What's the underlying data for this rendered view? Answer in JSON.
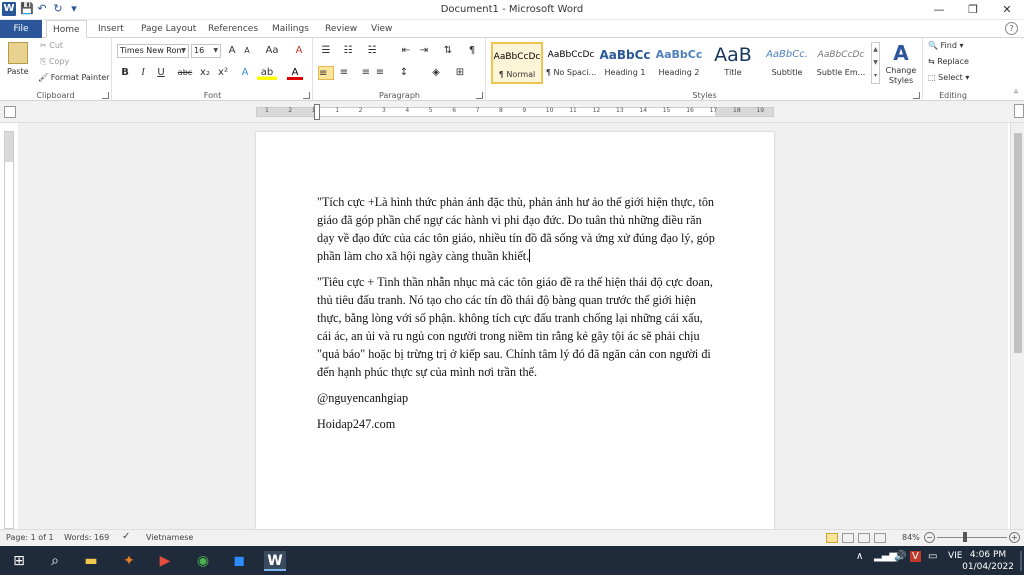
{
  "window": {
    "title": "Document1 - Microsoft Word",
    "minimize": "—",
    "restore": "❐",
    "close": "✕"
  },
  "qat": {
    "app_icon": "W",
    "save": "💾",
    "undo": "↶",
    "redo": "↻",
    "customize": "▾"
  },
  "tabs": {
    "file": "File",
    "home": "Home",
    "insert": "Insert",
    "page_layout": "Page Layout",
    "references": "References",
    "mailings": "Mailings",
    "review": "Review",
    "view": "View",
    "help": "?"
  },
  "clipboard": {
    "label": "Clipboard",
    "paste": "Paste",
    "cut": "Cut",
    "copy": "Copy",
    "format_painter": "Format Painter"
  },
  "font": {
    "label": "Font",
    "family": "Times New Rom",
    "size": "16",
    "grow": "A",
    "shrink": "A",
    "change_case": "Aa",
    "clear": "A",
    "bold": "B",
    "italic": "I",
    "underline": "U",
    "strike": "abc",
    "subscript": "x₂",
    "superscript": "x²",
    "effects": "A",
    "highlight": "ab",
    "color": "A"
  },
  "paragraph": {
    "label": "Paragraph",
    "bullets": "☰",
    "numbering": "☷",
    "multilevel": "☵",
    "decrease_indent": "⇤",
    "increase_indent": "⇥",
    "sort": "⇅",
    "show_marks": "¶",
    "align_left": "≡",
    "center": "≡",
    "align_right": "≡",
    "justify": "≡",
    "line_spacing": "↕",
    "shading": "◈",
    "borders": "⊞"
  },
  "styles": {
    "label": "Styles",
    "items": [
      {
        "preview": "AaBbCcDc",
        "name": "¶ Normal"
      },
      {
        "preview": "AaBbCcDc",
        "name": "¶ No Spaci..."
      },
      {
        "preview": "AaBbCc",
        "name": "Heading 1"
      },
      {
        "preview": "AaBbCc",
        "name": "Heading 2"
      },
      {
        "preview": "AaB",
        "name": "Title"
      },
      {
        "preview": "AaBbCc.",
        "name": "Subtitle"
      },
      {
        "preview": "AaBbCcDc",
        "name": "Subtle Em..."
      }
    ],
    "change_styles": "Change Styles"
  },
  "editing": {
    "label": "Editing",
    "find": "Find",
    "replace": "Replace",
    "select": "Select"
  },
  "ruler": {
    "numbers": [
      "1",
      "2",
      "1",
      "1",
      "2",
      "3",
      "4",
      "5",
      "6",
      "7",
      "8",
      "9",
      "10",
      "11",
      "12",
      "13",
      "14",
      "15",
      "16",
      "17",
      "18",
      "19"
    ]
  },
  "document": {
    "paragraphs": [
      "\"Tích cực +Là hình thức phản ánh đặc thù, phản ánh hư ảo thế giới hiện thực, tôn giáo đã góp phần chế ngự các hành vi phi đạo đức. Do tuân thủ những điều răn dạy về đạo đức của các tôn giáo, nhiều tín đồ đã sống và ứng xử đúng đạo lý, góp phần làm cho xã hội ngày càng thuần khiết.",
      "\"Tiêu cực + Tinh thần nhẫn nhục mà các tôn giáo đề ra thể hiện thái độ cực đoan, thủ tiêu đấu tranh. Nó tạo cho các tín đồ thái độ bàng quan trước thế giới hiện thực, bằng lòng với số phận. không tích cực đấu tranh chống lại những cái xấu, cái ác, an ủi và ru ngủ con người trong niềm tin rằng kẻ gây tội ác sẽ phải chịu \"quả báo\" hoặc bị trừng trị ở kiếp sau. Chính tâm lý đó đã ngăn cản con người đi đến hạnh phúc thực sự của mình nơi trần thế.",
      "@nguyencanhgiap",
      "Hoidap247.com"
    ]
  },
  "status": {
    "page": "Page: 1 of 1",
    "words": "Words: 169",
    "proof": "✓",
    "language": "Vietnamese",
    "zoom": "84%",
    "zoom_minus": "−",
    "zoom_plus": "+"
  },
  "taskbar": {
    "start": "⊞",
    "search": "⌕",
    "explorer": "▬",
    "app2": "✦",
    "media": "▶",
    "chrome": "◉",
    "zoom": "◼",
    "word": "W",
    "tray_up": "∧",
    "lang": "VIE",
    "time": "4:06 PM",
    "date": "01/04/2022"
  },
  "colors": {
    "word_blue": "#2b579a",
    "style_selected": "#f2c553",
    "taskbar": "#1f2b3a"
  }
}
